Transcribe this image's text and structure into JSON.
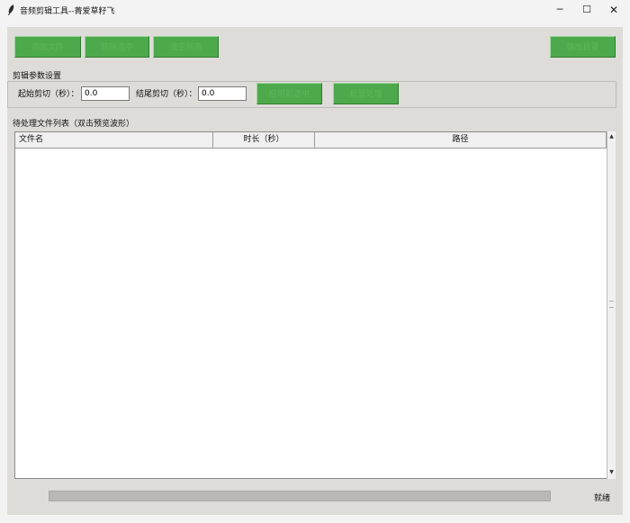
{
  "window": {
    "title": "音频剪辑工具--菁爱草籽飞",
    "minimize_glyph": "─",
    "maximize_glyph": "☐",
    "close_glyph": "✕"
  },
  "toolbar": {
    "add_files_label": "添加文件",
    "remove_label": "移除选中",
    "clear_label": "清空列表",
    "output_dir_label": "输出目录"
  },
  "params": {
    "section_label": "剪辑参数设置",
    "start_trim_label": "起始剪切（秒）：",
    "start_trim_value": "0.0",
    "end_trim_label": "结尾剪切（秒）：",
    "end_trim_value": "0.0",
    "apply_label": "应用到选中",
    "process_label": "批量处理"
  },
  "file_list": {
    "section_label": "待处理文件列表（双击预览波形）",
    "columns": [
      "文件名",
      "时长（秒）",
      "路径"
    ],
    "rows": []
  },
  "status_bar": {
    "progress": 0,
    "status_text": "就绪"
  },
  "colors": {
    "button_green": "#4caa4c",
    "window_bg": "#dedcd8"
  },
  "icons": {
    "app": "feather-icon",
    "scroll_up": "triangle-up",
    "scroll_down": "triangle-down"
  }
}
